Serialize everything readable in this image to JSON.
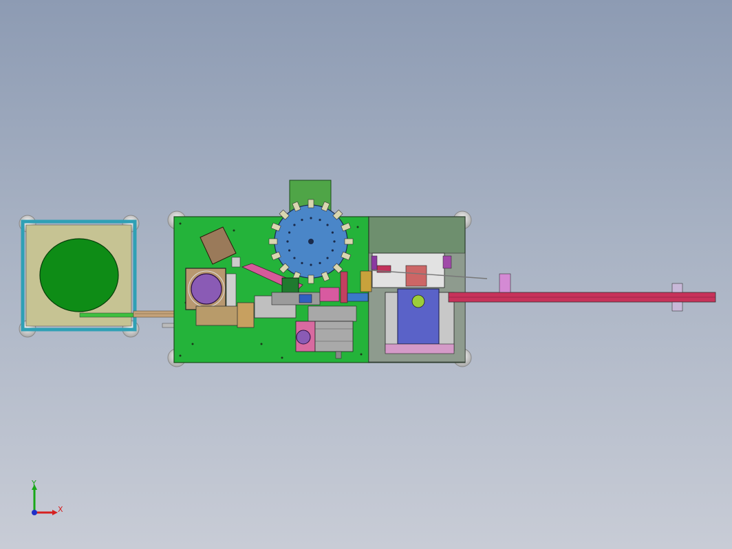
{
  "viewport": {
    "background_top": "#8d9bb3",
    "background_bottom": "#c8ccd6"
  },
  "triad": {
    "x_label": "X",
    "y_label": "Y",
    "x_color": "#d62020",
    "y_color": "#18a818",
    "z_color": "#2030c8"
  },
  "colors": {
    "main_base": "#24b33a",
    "feeder_table": "#c6c393",
    "feeder_frame": "#2fa0b5",
    "feeder_bowl": "#0e8c16",
    "turntable": "#4a86c8",
    "right_base": "#6e8f6e",
    "conveyor_red": "#c7325a",
    "purple_part": "#8a5bb5",
    "blue_module": "#5a62c8"
  }
}
